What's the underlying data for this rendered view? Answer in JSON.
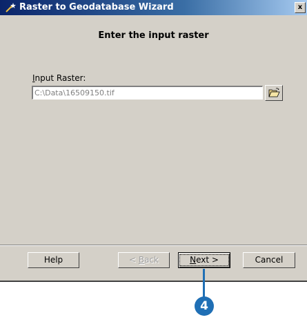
{
  "window": {
    "title": "Raster to Geodatabase Wizard",
    "close_label": "x"
  },
  "page": {
    "heading": "Enter the input raster"
  },
  "input_raster": {
    "label_mnemonic": "I",
    "label_rest": "nput Raster:",
    "value": "C:\\Data\\16509150.tif"
  },
  "buttons": {
    "help": "Help",
    "back_mnemonic": "B",
    "back_prefix": "< ",
    "back_rest": "ack",
    "next_mnemonic": "N",
    "next_rest": "ext >",
    "cancel": "Cancel"
  },
  "callout": {
    "number": "4",
    "color": "#1f6fb5"
  },
  "icons": {
    "title": "wizard-wand-icon",
    "browse": "open-folder-icon"
  }
}
